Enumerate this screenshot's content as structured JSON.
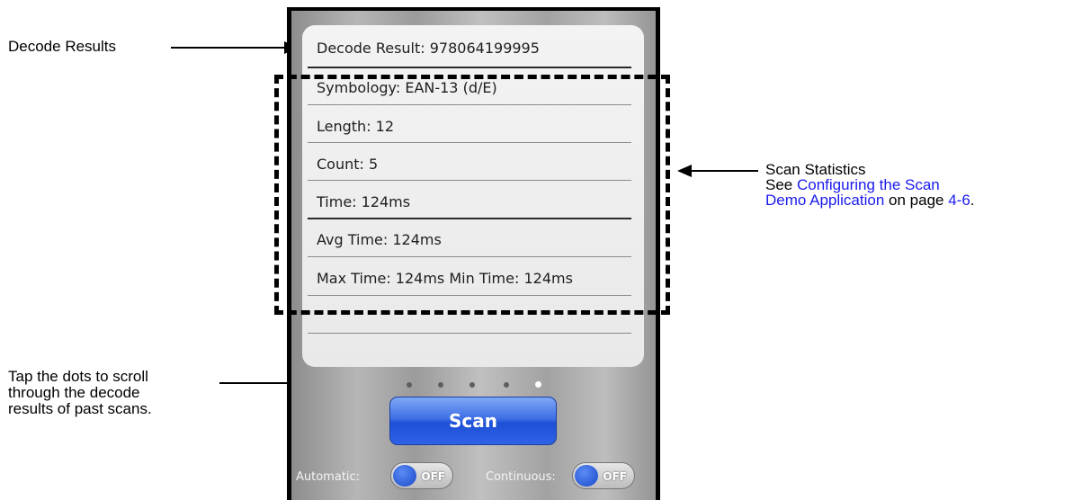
{
  "annotations": {
    "decode_results": "Decode Results",
    "scan_statistics": "Scan Statistics",
    "see_prefix": "See ",
    "link_line1": "Configuring the Scan",
    "link_line2": "Demo Application",
    "on_page": " on page ",
    "page_ref": "4-6",
    "period": ".",
    "tap_line1": "Tap the dots to scroll",
    "tap_line2": "through the decode",
    "tap_line3": "results of past scans."
  },
  "results": {
    "decode_result": "Decode Result: 978064199995",
    "symbology": "Symbology: EAN-13 (d/E)",
    "length": "Length: 12",
    "count": "Count: 5",
    "time": "Time: 124ms",
    "avg_time": "Avg Time: 124ms",
    "max_min_time": "Max Time: 124ms  Min Time: 124ms"
  },
  "pager": {
    "dot_count": 5,
    "active_index": 4
  },
  "controls": {
    "scan_label": "Scan",
    "automatic_label": "Automatic:",
    "automatic_state": "OFF",
    "continuous_label": "Continuous:",
    "continuous_state": "OFF"
  },
  "colors": {
    "link": "#1a1aee",
    "scan_button": "#2f63e6"
  }
}
